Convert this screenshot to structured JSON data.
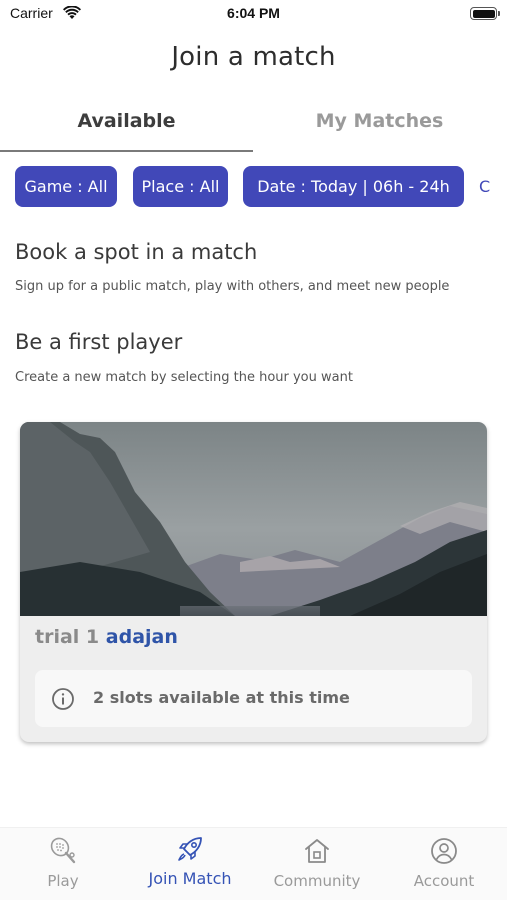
{
  "status_bar": {
    "carrier": "Carrier",
    "time": "6:04 PM"
  },
  "header": {
    "title": "Join a match"
  },
  "tabs": [
    {
      "label": "Available",
      "active": true
    },
    {
      "label": "My Matches",
      "active": false
    }
  ],
  "filters": {
    "game": "Game : All",
    "place": "Place : All",
    "date": "Date : Today | 06h - 24h",
    "clear": "C"
  },
  "sections": [
    {
      "title": "Book a spot in a match",
      "subtitle": "Sign up for a public match, play with others, and meet new people"
    },
    {
      "title": "Be a first player",
      "subtitle": "Create a new match by selecting the hour you want"
    }
  ],
  "match_card": {
    "name": "trial 1",
    "place": "adajan",
    "slots": "2 slots available at this time"
  },
  "nav": [
    {
      "label": "Play",
      "icon": "padel-racket-icon",
      "active": false
    },
    {
      "label": "Join Match",
      "icon": "rocket-icon",
      "active": true
    },
    {
      "label": "Community",
      "icon": "home-icon",
      "active": false
    },
    {
      "label": "Account",
      "icon": "user-circle-icon",
      "active": false
    }
  ],
  "colors": {
    "accent": "#4148b8",
    "active_nav": "#3553b5",
    "place_link": "#2f54a8"
  }
}
